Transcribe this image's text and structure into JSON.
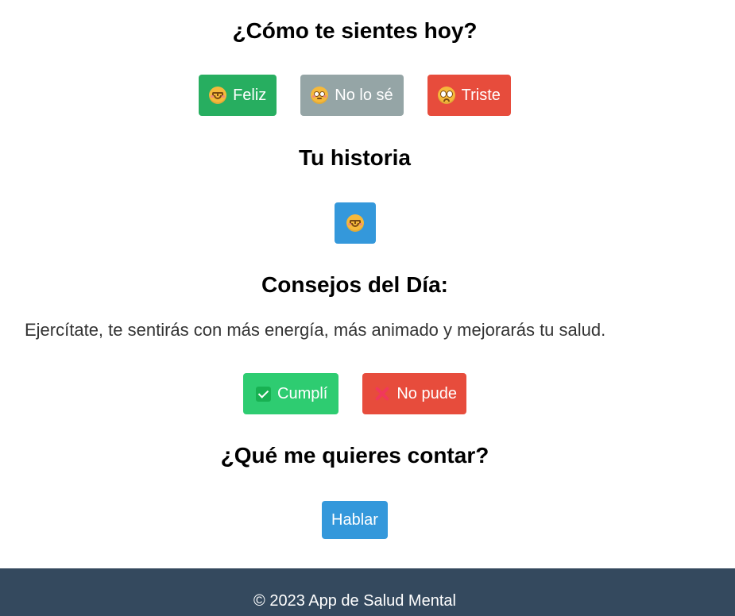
{
  "mood": {
    "title": "¿Cómo te sientes hoy?",
    "buttons": [
      {
        "label": "Feliz",
        "icon": "smiling-face-icon",
        "color": "#27ae60"
      },
      {
        "label": "No lo sé",
        "icon": "flushed-face-icon",
        "color": "#95a5a6"
      },
      {
        "label": "Triste",
        "icon": "pleading-face-icon",
        "color": "#e74c3c"
      }
    ]
  },
  "history": {
    "title": "Tu historia",
    "entry_icon": "smiling-face-icon",
    "entry_color": "#3498db"
  },
  "tips": {
    "title": "Consejos del Día:",
    "text": "Ejercítate, te sentirás con más energía, más animado y mejorarás tu salud.",
    "done_label": "Cumplí",
    "done_icon": "check-mark-icon",
    "done_color": "#2ecc71",
    "fail_label": "No pude",
    "fail_icon": "cross-mark-icon",
    "fail_color": "#e74c3c"
  },
  "talk": {
    "title": "¿Qué me quieres contar?",
    "button_label": "Hablar",
    "button_color": "#3498db"
  },
  "footer": {
    "text": "© 2023 App de Salud Mental",
    "color": "#34495e"
  }
}
